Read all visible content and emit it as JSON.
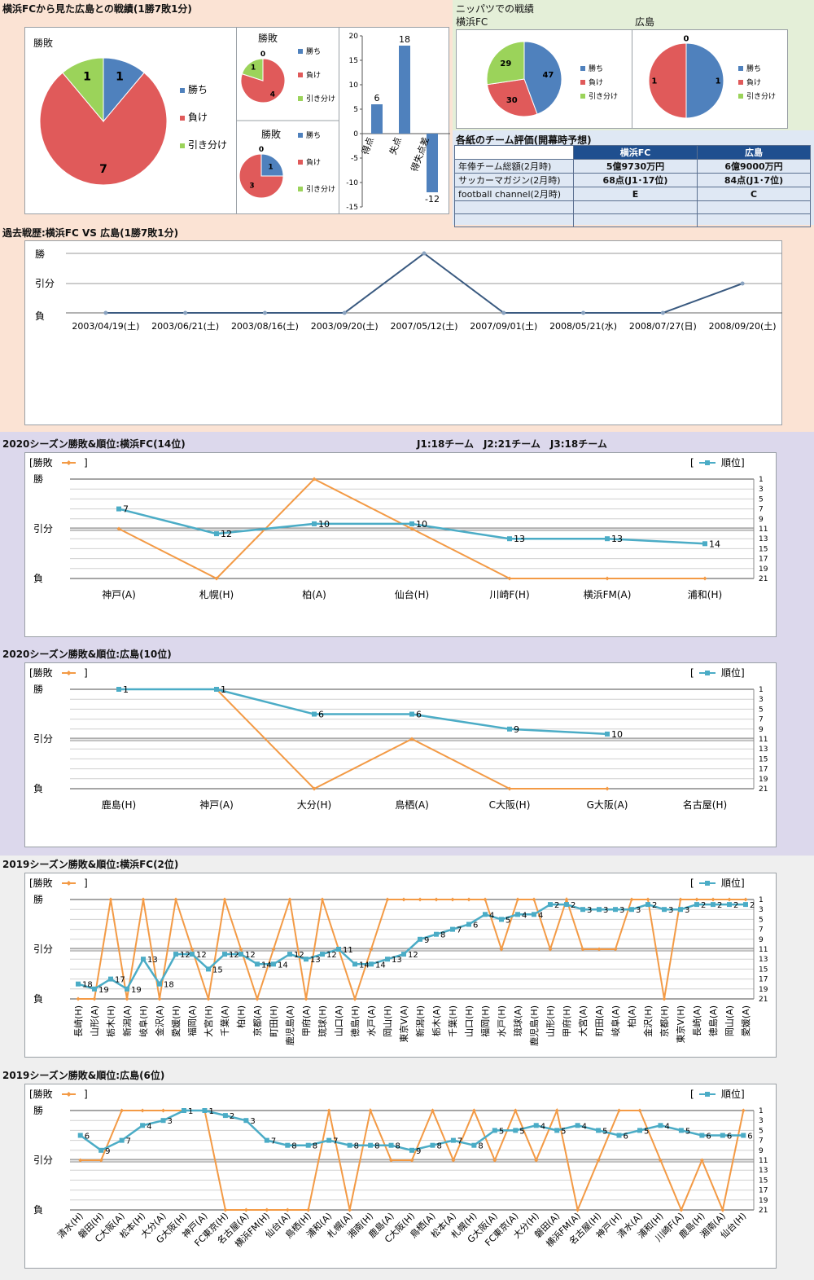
{
  "colors": {
    "win": "#4f81bd",
    "loss": "#e05a5a",
    "draw": "#9bd35a",
    "result_line": "#f39a45",
    "rank_line": "#4bacc6",
    "history_line": "#3a5a80",
    "eval_header": "#1f4f8f"
  },
  "head2head": {
    "title": "横浜FCから見た広島との戦績(1勝7敗1分)",
    "legend": [
      "勝ち",
      "負け",
      "引き分け"
    ],
    "big_pie": {
      "title": "勝敗",
      "values": [
        1,
        7,
        1
      ],
      "labels": [
        "1",
        "7",
        "1"
      ]
    },
    "small_pie_1": {
      "title": "勝敗",
      "values": [
        0,
        4,
        1
      ],
      "labels": [
        "0",
        "4",
        "1"
      ]
    },
    "small_pie_2": {
      "title": "勝敗",
      "values": [
        1,
        3,
        0
      ],
      "labels": [
        "1",
        "3",
        "0"
      ]
    },
    "small_legend": [
      "勝ち",
      "負け",
      "引き分け"
    ]
  },
  "goal_bars": {
    "chart_data": {
      "type": "bar",
      "categories": [
        "得点",
        "失点",
        "得失点差"
      ],
      "values": [
        6,
        18,
        -12
      ],
      "ylim": [
        -15,
        20
      ],
      "yticks": [
        "20",
        "15",
        "10",
        "5",
        "0",
        "-5",
        "-10",
        "-15"
      ],
      "value_labels": [
        "6",
        "18",
        "-12"
      ]
    }
  },
  "nippatsu": {
    "title": "ニッパツでの戦績",
    "yokohama": {
      "label": "横浜FC",
      "values": [
        47,
        30,
        29
      ],
      "labels": [
        "47",
        "30",
        "29"
      ]
    },
    "hiroshima": {
      "label": "広島",
      "values": [
        1,
        1,
        0
      ],
      "labels": [
        "1",
        "1",
        "0"
      ]
    },
    "legend": [
      "勝ち",
      "負け",
      "引き分け"
    ]
  },
  "evaluation": {
    "title": "各紙のチーム評価(開幕時予想)",
    "headers": [
      "横浜FC",
      "広島"
    ],
    "rows": [
      {
        "label": "年俸チーム総額(2月時)",
        "a": "5億9730万円",
        "b": "6億9000万円"
      },
      {
        "label": "サッカーマガジン(2月時)",
        "a": "68点(J1･17位)",
        "b": "84点(J1･7位)"
      },
      {
        "label": "football channel(2月時)",
        "a": "E",
        "b": "C"
      },
      {
        "label": "",
        "a": "",
        "b": ""
      },
      {
        "label": "",
        "a": "",
        "b": ""
      }
    ]
  },
  "history": {
    "title": "過去戦歴:横浜FC VS 広島(1勝7敗1分)",
    "chart_data": {
      "type": "line",
      "categories": [
        "2003/04/19(土)",
        "2003/06/21(土)",
        "2003/08/16(土)",
        "2003/09/20(土)",
        "2007/05/12(土)",
        "2007/09/01(土)",
        "2008/05/21(水)",
        "2008/07/27(日)",
        "2008/09/20(土)"
      ],
      "values": [
        0,
        0,
        0,
        0,
        2,
        0,
        0,
        0,
        1
      ],
      "y_labels": [
        "勝",
        "引分",
        "負"
      ]
    }
  },
  "common": {
    "result_legend": "[勝敗",
    "result_close": "]",
    "rank_legend": "[",
    "rank_label": "順位]",
    "y_labels": [
      "勝",
      "引分",
      "負"
    ],
    "rank_ticks": [
      "1",
      "3",
      "5",
      "7",
      "9",
      "11",
      "13",
      "15",
      "17",
      "19",
      "21"
    ]
  },
  "league_info": "J1:18チーム　J2:21チーム　J3:18チーム",
  "s2020_yfc": {
    "title": "2020シーズン勝敗&順位:横浜FC(14位)",
    "chart_data": {
      "type": "line",
      "categories": [
        "神戸(A)",
        "札幌(H)",
        "柏(A)",
        "仙台(H)",
        "川崎F(H)",
        "横浜FM(A)",
        "浦和(H)"
      ],
      "results": [
        1,
        0,
        2,
        1,
        0,
        0,
        0
      ],
      "ranks": [
        7,
        12,
        10,
        10,
        13,
        13,
        14
      ]
    }
  },
  "s2020_hir": {
    "title": "2020シーズン勝敗&順位:広島(10位)",
    "chart_data": {
      "type": "line",
      "categories": [
        "鹿島(H)",
        "神戸(A)",
        "大分(H)",
        "鳥栖(A)",
        "C大阪(H)",
        "G大阪(A)",
        "名古屋(H)"
      ],
      "results": [
        2,
        2,
        0,
        1,
        0,
        0,
        null
      ],
      "ranks": [
        1,
        1,
        6,
        6,
        9,
        10,
        null
      ]
    }
  },
  "s2019_yfc": {
    "title": "2019シーズン勝敗&順位:横浜FC(2位)",
    "chart_data": {
      "type": "line",
      "categories": [
        "長崎(H)",
        "山形(A)",
        "栃木(H)",
        "新潟(A)",
        "岐阜(H)",
        "金沢(A)",
        "愛媛(H)",
        "福岡(A)",
        "大宮(H)",
        "千葉(A)",
        "柏(H)",
        "京都(A)",
        "町田(H)",
        "鹿児島(A)",
        "甲府(A)",
        "琉球(H)",
        "山口(A)",
        "徳島(H)",
        "水戸(A)",
        "岡山(H)",
        "東京V(A)",
        "新潟(H)",
        "栃木(A)",
        "千葉(H)",
        "山口(H)",
        "福岡(H)",
        "水戸(H)",
        "琉球(A)",
        "鹿児島(H)",
        "山形(H)",
        "甲府(H)",
        "大宮(A)",
        "町田(A)",
        "岐阜(A)",
        "柏(A)",
        "金沢(H)",
        "京都(H)",
        "東京V(H)",
        "長崎(A)",
        "徳島(A)",
        "岡山(A)",
        "愛媛(A)"
      ],
      "results": [
        0,
        0,
        2,
        0,
        2,
        0,
        2,
        1,
        0,
        2,
        1,
        0,
        1,
        2,
        0,
        2,
        1,
        0,
        1,
        2,
        2,
        2,
        2,
        2,
        2,
        2,
        1,
        2,
        2,
        1,
        2,
        1,
        1,
        1,
        2,
        2,
        0,
        2,
        2,
        2,
        2,
        2
      ],
      "ranks": [
        18,
        19,
        17,
        19,
        13,
        18,
        12,
        12,
        15,
        12,
        12,
        14,
        14,
        12,
        13,
        12,
        11,
        14,
        14,
        13,
        12,
        9,
        8,
        7,
        6,
        4,
        5,
        4,
        4,
        2,
        2,
        3,
        3,
        3,
        3,
        2,
        3,
        3,
        2,
        2,
        2,
        2
      ]
    }
  },
  "s2019_hir": {
    "title": "2019シーズン勝敗&順位:広島(6位)",
    "chart_data": {
      "type": "line",
      "categories": [
        "清水(H)",
        "磐田(H)",
        "C大阪(A)",
        "松本(H)",
        "大分(A)",
        "G大阪(H)",
        "神戸(A)",
        "FC東京(H)",
        "名古屋(A)",
        "横浜FM(H)",
        "仙台(A)",
        "鳥栖(H)",
        "浦和(A)",
        "札幌(A)",
        "湘南(H)",
        "鹿島(A)",
        "C大阪(H)",
        "鳥栖(A)",
        "松本(A)",
        "札幌(H)",
        "G大阪(A)",
        "FC東京(A)",
        "大分(H)",
        "磐田(A)",
        "横浜FM(A)",
        "名古屋(H)",
        "神戸(H)",
        "清水(A)",
        "浦和(H)",
        "川崎F(A)",
        "鹿島(H)",
        "湘南(A)",
        "仙台(H)"
      ],
      "results": [
        1,
        1,
        2,
        2,
        2,
        2,
        2,
        0,
        0,
        0,
        0,
        0,
        2,
        0,
        2,
        1,
        1,
        2,
        1,
        2,
        1,
        2,
        1,
        2,
        0,
        1,
        2,
        2,
        1,
        0,
        1,
        0,
        2
      ],
      "ranks": [
        6,
        9,
        7,
        4,
        3,
        1,
        1,
        2,
        3,
        7,
        8,
        8,
        7,
        8,
        8,
        8,
        9,
        8,
        7,
        8,
        5,
        5,
        4,
        5,
        4,
        5,
        6,
        5,
        4,
        5,
        6,
        6,
        6
      ]
    }
  }
}
